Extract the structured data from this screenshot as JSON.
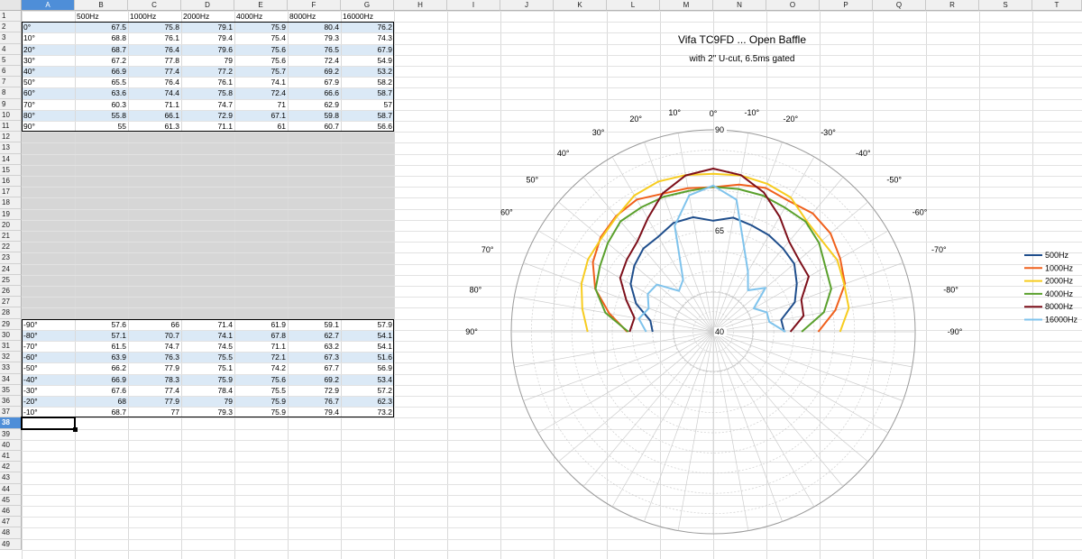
{
  "sheet": {
    "columns": [
      "A",
      "B",
      "C",
      "D",
      "E",
      "F",
      "G",
      "H",
      "I",
      "J",
      "K",
      "L",
      "M",
      "N",
      "O",
      "P",
      "Q",
      "R",
      "S",
      "T"
    ],
    "selected_column": "A",
    "rows": [
      "1",
      "2",
      "3",
      "4",
      "5",
      "6",
      "7",
      "8",
      "9",
      "10",
      "11",
      "12",
      "13",
      "14",
      "15",
      "16",
      "17",
      "18",
      "19",
      "20",
      "21",
      "22",
      "23",
      "24",
      "25",
      "26",
      "27",
      "28",
      "29",
      "30",
      "31",
      "32",
      "33",
      "34",
      "35",
      "36",
      "37",
      "38",
      "39",
      "40",
      "41",
      "42",
      "43",
      "44",
      "45",
      "46",
      "47",
      "48",
      "49"
    ],
    "selected_row": "38",
    "header_row": [
      "",
      "500Hz",
      "1000Hz",
      "2000Hz",
      "4000Hz",
      "8000Hz",
      "16000Hz"
    ],
    "top_block": [
      [
        "0°",
        "67.5",
        "75.8",
        "79.1",
        "75.9",
        "80.4",
        "76.2"
      ],
      [
        "10°",
        "68.8",
        "76.1",
        "79.4",
        "75.4",
        "79.3",
        "74.3"
      ],
      [
        "20°",
        "68.7",
        "76.4",
        "79.6",
        "75.6",
        "76.5",
        "67.9"
      ],
      [
        "30°",
        "67.2",
        "77.8",
        "79",
        "75.6",
        "72.4",
        "54.9"
      ],
      [
        "40°",
        "66.9",
        "77.4",
        "77.2",
        "75.7",
        "69.2",
        "53.2"
      ],
      [
        "50°",
        "65.5",
        "76.4",
        "76.1",
        "74.1",
        "67.9",
        "58.2"
      ],
      [
        "60°",
        "63.6",
        "74.4",
        "75.8",
        "72.4",
        "66.6",
        "58.7"
      ],
      [
        "70°",
        "60.3",
        "71.1",
        "74.7",
        "71",
        "62.9",
        "57"
      ],
      [
        "80°",
        "55.8",
        "66.1",
        "72.9",
        "67.1",
        "59.8",
        "58.7"
      ],
      [
        "90°",
        "55",
        "61.3",
        "71.1",
        "61",
        "60.7",
        "56.6"
      ]
    ],
    "bottom_block": [
      [
        "-90°",
        "57.6",
        "66",
        "71.4",
        "61.9",
        "59.1",
        "57.9"
      ],
      [
        "-80°",
        "57.1",
        "70.7",
        "74.1",
        "67.8",
        "62.7",
        "54.1"
      ],
      [
        "-70°",
        "61.5",
        "74.7",
        "74.5",
        "71.1",
        "63.2",
        "54.1"
      ],
      [
        "-60°",
        "63.9",
        "76.3",
        "75.5",
        "72.1",
        "67.3",
        "51.6"
      ],
      [
        "-50°",
        "66.2",
        "77.9",
        "75.1",
        "74.2",
        "67.7",
        "56.9"
      ],
      [
        "-40°",
        "66.9",
        "78.3",
        "75.9",
        "75.6",
        "69.2",
        "53.4"
      ],
      [
        "-30°",
        "67.6",
        "77.4",
        "78.4",
        "75.5",
        "72.9",
        "57.2"
      ],
      [
        "-20°",
        "68",
        "77.9",
        "79",
        "75.9",
        "76.7",
        "62.3"
      ],
      [
        "-10°",
        "68.7",
        "77",
        "79.3",
        "75.9",
        "79.4",
        "73.2"
      ]
    ]
  },
  "chart_data": {
    "type": "polar-line",
    "title": "Vifa TC9FD ... Open Baffle",
    "subtitle": "with 2\" U-cut, 6.5ms gated",
    "angle_labels": [
      "0°",
      "10°",
      "20°",
      "30°",
      "40°",
      "50°",
      "60°",
      "70°",
      "80°",
      "90°",
      "-10°",
      "-20°",
      "-30°",
      "-40°",
      "-50°",
      "-60°",
      "-70°",
      "-80°",
      "-90°"
    ],
    "angles": [
      0,
      10,
      20,
      30,
      40,
      50,
      60,
      70,
      80,
      90,
      -10,
      -20,
      -30,
      -40,
      -50,
      -60,
      -70,
      -80,
      -90
    ],
    "radial_labels": [
      "40",
      "65",
      "90"
    ],
    "rlim": [
      40,
      90
    ],
    "radial_ticks": [
      40,
      45,
      50,
      55,
      60,
      65,
      70,
      75,
      80,
      85,
      90
    ],
    "angular_grid_step": 10,
    "legend_position": "right",
    "series": [
      {
        "name": "500Hz",
        "color": "#1f4e8c",
        "pos": [
          67.5,
          68.8,
          68.7,
          67.2,
          66.9,
          65.5,
          63.6,
          60.3,
          55.8,
          55
        ],
        "neg": [
          67.5,
          68.7,
          68,
          67.6,
          66.9,
          66.2,
          63.9,
          61.5,
          57.1,
          57.6
        ]
      },
      {
        "name": "1000Hz",
        "color": "#f0601c",
        "pos": [
          75.8,
          76.1,
          76.4,
          77.8,
          77.4,
          76.4,
          74.4,
          71.1,
          66.1,
          61.3
        ],
        "neg": [
          75.8,
          77,
          77.9,
          77.4,
          78.3,
          77.9,
          76.3,
          74.7,
          70.7,
          66
        ]
      },
      {
        "name": "2000Hz",
        "color": "#f7cc1f",
        "pos": [
          79.1,
          79.4,
          79.6,
          79,
          77.2,
          76.1,
          75.8,
          74.7,
          72.9,
          71.1
        ],
        "neg": [
          79.1,
          79.3,
          79,
          78.4,
          75.9,
          75.1,
          75.5,
          74.5,
          74.1,
          71.4
        ]
      },
      {
        "name": "4000Hz",
        "color": "#5aa02c",
        "pos": [
          75.9,
          75.4,
          75.6,
          75.6,
          75.7,
          74.1,
          72.4,
          71,
          67.1,
          61
        ],
        "neg": [
          75.9,
          75.9,
          75.9,
          75.5,
          75.6,
          74.2,
          72.1,
          71.1,
          67.8,
          61.9
        ]
      },
      {
        "name": "8000Hz",
        "color": "#7d0f1a",
        "pos": [
          80.4,
          79.3,
          76.5,
          72.4,
          69.2,
          67.9,
          66.6,
          62.9,
          59.8,
          60.7
        ],
        "neg": [
          80.4,
          79.4,
          76.7,
          72.9,
          69.2,
          67.7,
          67.3,
          63.2,
          62.7,
          59.1
        ]
      },
      {
        "name": "16000Hz",
        "color": "#7fc3ec",
        "pos": [
          76.2,
          74.3,
          67.9,
          54.9,
          53.2,
          58.2,
          58.7,
          57,
          58.7,
          56.6
        ],
        "neg": [
          76.2,
          73.2,
          62.3,
          57.2,
          53.4,
          56.9,
          51.6,
          54.1,
          54.1,
          57.9
        ]
      }
    ]
  }
}
